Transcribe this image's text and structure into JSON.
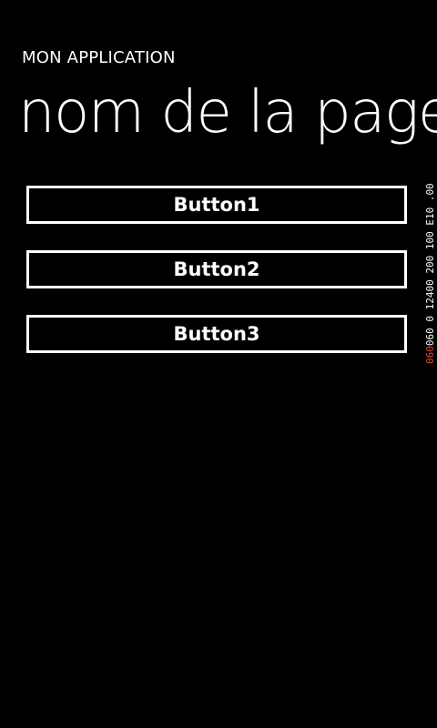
{
  "header": {
    "app_title": "MON APPLICATION",
    "page_title": "nom de la page"
  },
  "buttons": [
    {
      "label": "Button1"
    },
    {
      "label": "Button2"
    },
    {
      "label": "Button3"
    }
  ],
  "fps_counter": {
    "accent_text": "060",
    "text": " 060 0 12400 200 100 E10 .00 ",
    "accent_color": "#e8502a",
    "text_color": "#ffffff"
  },
  "colors": {
    "background": "#000000",
    "foreground": "#ffffff"
  }
}
